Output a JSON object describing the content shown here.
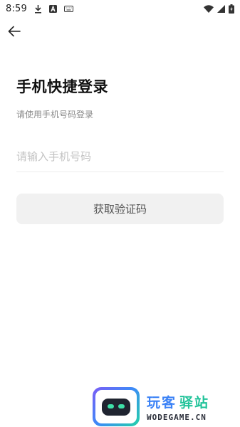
{
  "status_bar": {
    "time": "8:59",
    "left_icons": [
      "download-icon",
      "text-a-icon",
      "keyboard-icon"
    ],
    "right_icons": [
      "wifi-icon",
      "signal-icon",
      "battery-icon"
    ]
  },
  "header": {
    "back_icon": "arrow-left-icon"
  },
  "login": {
    "title": "手机快捷登录",
    "subtitle": "请使用手机号码登录",
    "phone_placeholder": "请输入手机号码",
    "phone_value": "",
    "get_code_label": "获取验证码"
  },
  "watermark": {
    "cn_part1": "玩客",
    "cn_part2": "驿站",
    "en": "WODEGAME.CN"
  },
  "colors": {
    "button_bg": "#f1f1f1",
    "placeholder": "#c3c3c3",
    "subtitle": "#8a8a8a",
    "watermark_blue": "#3b82f6",
    "watermark_green": "#22c39a"
  }
}
